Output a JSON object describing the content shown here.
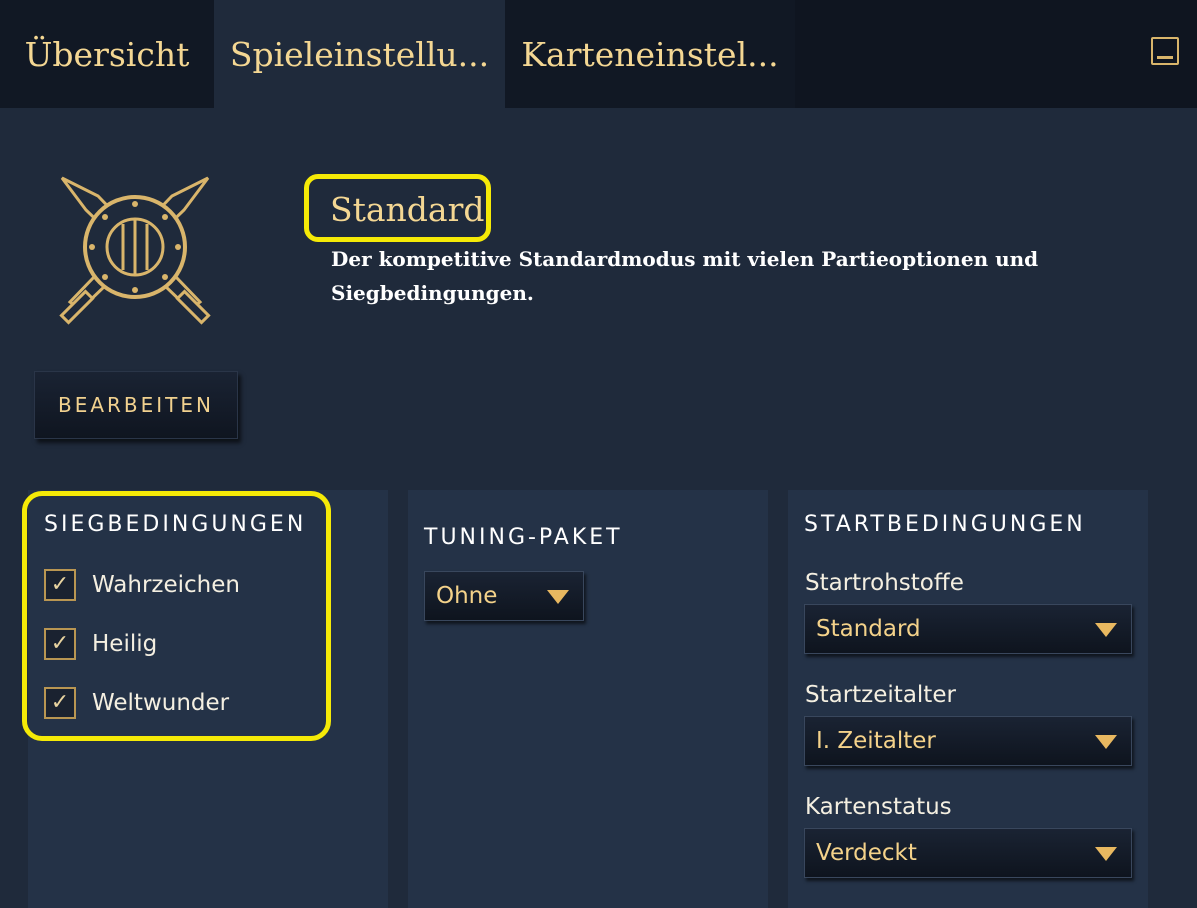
{
  "tabs": [
    {
      "label": "Übersicht"
    },
    {
      "label": "Spieleinstellu..."
    },
    {
      "label": "Karteneinstel..."
    }
  ],
  "mode": {
    "title": "Standard",
    "description": "Der kompetitive Standardmodus mit vielen Partieoptionen und Siegbedingungen.",
    "edit_label": "BEARBEITEN"
  },
  "victory": {
    "title": "SIEGBEDINGUNGEN",
    "items": [
      {
        "label": "Wahrzeichen",
        "checked": true
      },
      {
        "label": "Heilig",
        "checked": true
      },
      {
        "label": "Weltwunder",
        "checked": true
      }
    ]
  },
  "tuning": {
    "title": "TUNING-PAKET",
    "selected": "Ohne"
  },
  "start": {
    "title": "STARTBEDINGUNGEN",
    "resources_label": "Startrohstoffe",
    "resources_value": "Standard",
    "age_label": "Startzeitalter",
    "age_value": "I. Zeitalter",
    "map_label": "Kartenstatus",
    "map_value": "Verdeckt"
  },
  "colors": {
    "background": "#1f2a3b",
    "tabbar": "#0f1520",
    "gold_text": "#f4d793",
    "highlight": "#f5ea07"
  }
}
